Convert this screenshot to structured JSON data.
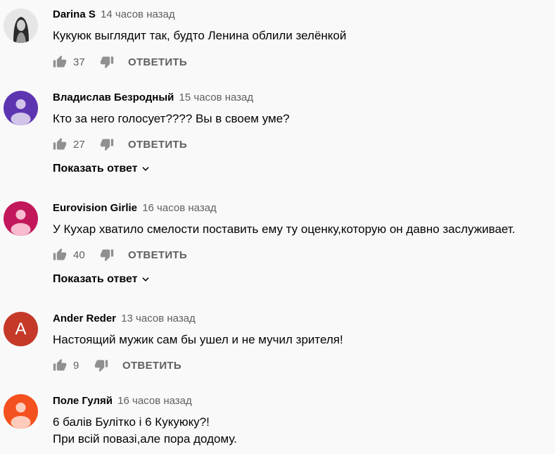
{
  "comments": [
    {
      "author": "Darina S",
      "time": "14 часов назад",
      "lines": [
        "Кукуюк выглядит так, будто Ленина облили зелёнкой"
      ],
      "likes": "37",
      "reply_label": "ОТВЕТИТЬ",
      "avatar": {
        "type": "photo",
        "bg": "#e8e8e8"
      }
    },
    {
      "author": "Владислав Безродный",
      "time": "15 часов назад",
      "lines": [
        "Кто за него голосует???? Вы в своем уме?"
      ],
      "likes": "27",
      "reply_label": "ОТВЕТИТЬ",
      "show_replies": "Показать ответ",
      "avatar": {
        "type": "person",
        "bg": "#5e35b1"
      }
    },
    {
      "author": "Eurovision Girlie",
      "time": "16 часов назад",
      "lines": [
        "У Кухар хватило смелости поставить ему ту оценку,которую он давно заслуживает."
      ],
      "likes": "40",
      "reply_label": "ОТВЕТИТЬ",
      "show_replies": "Показать ответ",
      "avatar": {
        "type": "person",
        "bg": "#c2185b"
      }
    },
    {
      "author": "Ander Reder",
      "time": "13 часов назад",
      "lines": [
        "Настоящий мужик сам бы ушел и не мучил зрителя!"
      ],
      "likes": "9",
      "reply_label": "ОТВЕТИТЬ",
      "avatar": {
        "type": "letter",
        "letter": "A",
        "bg": "#c53929"
      }
    },
    {
      "author": "Поле Гуляй",
      "time": "16 часов назад",
      "lines": [
        "6 балів Булітко і 6 Кукуюку?!",
        "При всій повазі,але пора додому."
      ],
      "avatar": {
        "type": "person",
        "bg": "#f4511e"
      }
    }
  ]
}
